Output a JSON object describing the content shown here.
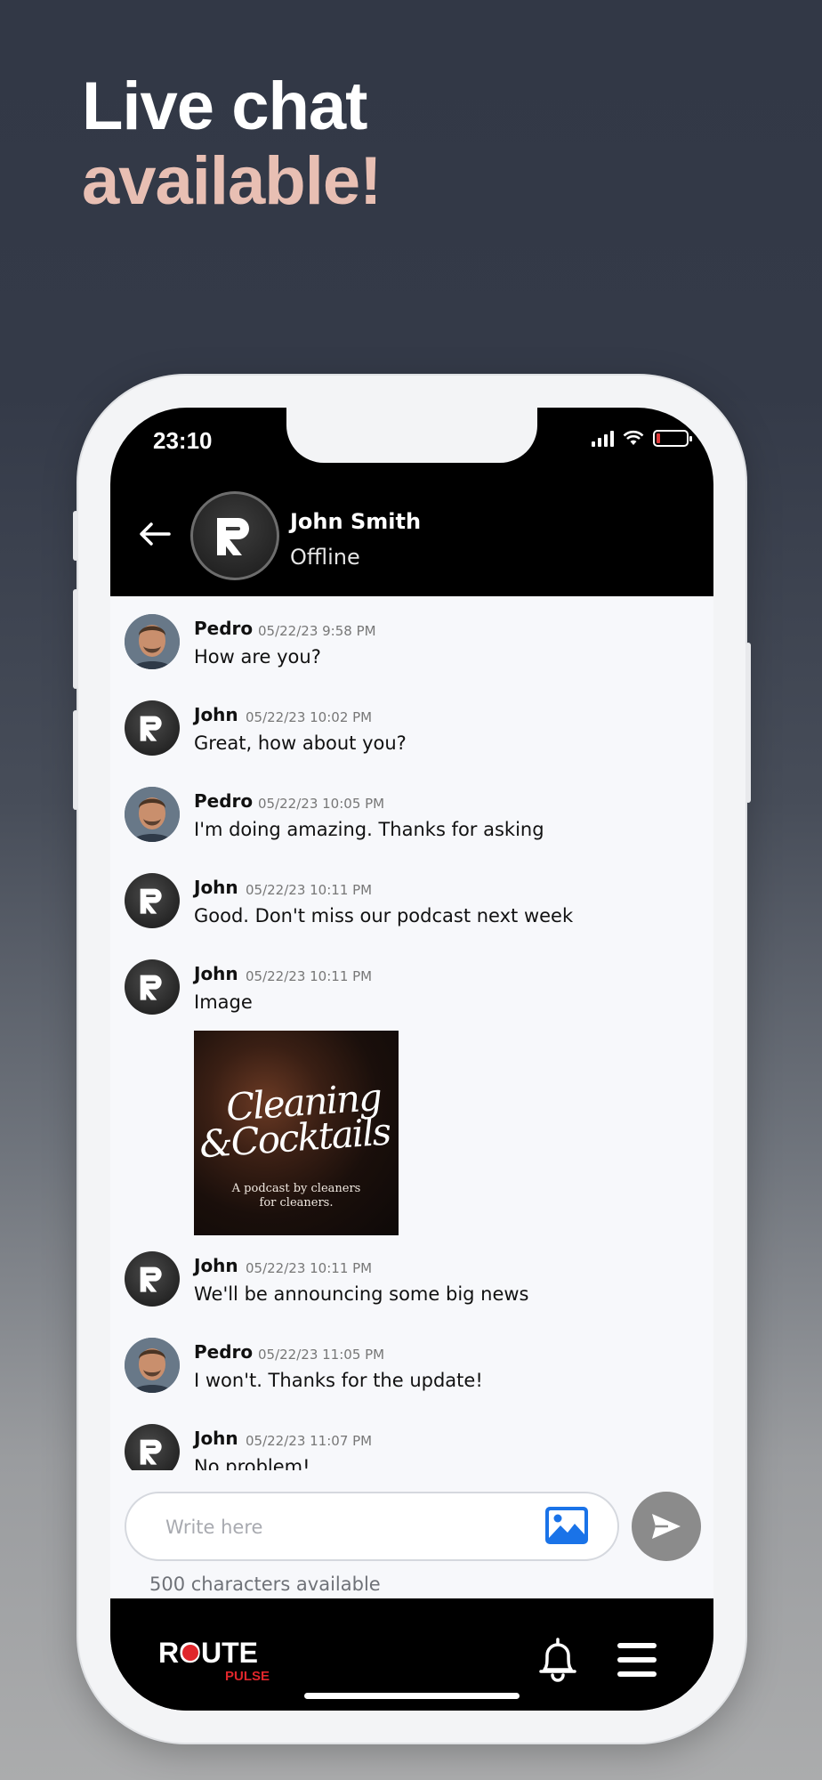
{
  "promo": {
    "line1": "Live chat",
    "line2": "available!",
    "line1_color": "#ffffff",
    "line2_color": "#e8bfb3"
  },
  "status_bar": {
    "time": "23:10",
    "icons": [
      "signal-icon",
      "wifi-icon",
      "battery-icon"
    ],
    "battery_color": "#e03a3a"
  },
  "chat_header": {
    "back_icon": "arrow-left-icon",
    "contact_name": "John Smith",
    "contact_status": "Offline"
  },
  "messages": [
    {
      "sender": "Pedro",
      "timestamp": "05/22/23 9:58 PM",
      "text": "How are you?"
    },
    {
      "sender": "John",
      "timestamp": "05/22/23 10:02 PM",
      "text": "Great, how about you?"
    },
    {
      "sender": "Pedro",
      "timestamp": "05/22/23 10:05 PM",
      "text": "I'm doing amazing. Thanks for asking"
    },
    {
      "sender": "John",
      "timestamp": "05/22/23 10:11 PM",
      "text": "Good. Don't miss our podcast next week"
    },
    {
      "sender": "John",
      "timestamp": "05/22/23 10:11 PM",
      "text": "Image",
      "image": {
        "title_line1": "Cleaning",
        "title_line2": "&Cocktails",
        "subtitle_line1": "A podcast by cleaners",
        "subtitle_line2": "for cleaners."
      }
    },
    {
      "sender": "John",
      "timestamp": "05/22/23 10:11 PM",
      "text": "We'll be announcing some big news"
    },
    {
      "sender": "Pedro",
      "timestamp": "05/22/23 11:05 PM",
      "text": "I won't. Thanks for the update!"
    },
    {
      "sender": "John",
      "timestamp": "05/22/23 11:07 PM",
      "text": "No problem!"
    }
  ],
  "composer": {
    "placeholder": "Write here",
    "value": "",
    "char_counter": "500 characters available",
    "attach_icon": "image-icon",
    "send_icon": "send-icon"
  },
  "bottom_bar": {
    "logo_text": "ROUTE",
    "logo_subtext": "PULSE",
    "logo_accent_color": "#e0262b",
    "icons": [
      "bell-icon",
      "menu-icon"
    ]
  }
}
